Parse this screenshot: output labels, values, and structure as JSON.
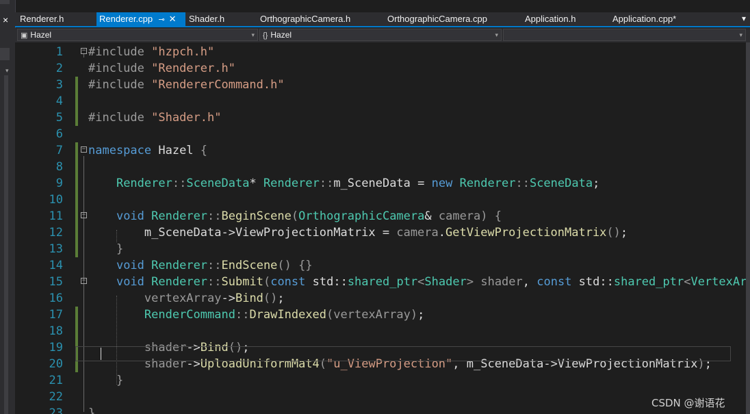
{
  "tabs": [
    {
      "label": "Renderer.h",
      "active": false
    },
    {
      "label": "Renderer.cpp",
      "active": true,
      "pin": "pin-icon",
      "close": "close-icon"
    },
    {
      "label": "Shader.h",
      "active": false
    },
    {
      "label": "OrthographicCamera.h",
      "active": false
    },
    {
      "label": "OrthographicCamera.cpp",
      "active": false
    },
    {
      "label": "Application.h",
      "active": false
    },
    {
      "label": "Application.cpp*",
      "active": false
    }
  ],
  "navbar": {
    "project": "Hazel",
    "scope_icon": "{}",
    "scope": "Hazel",
    "member": ""
  },
  "code_lines": [
    {
      "num": "1",
      "tokens": [
        [
          "pp",
          "#include "
        ],
        [
          "str",
          "\"hzpch.h\""
        ]
      ]
    },
    {
      "num": "2",
      "tokens": [
        [
          "pp",
          "#include "
        ],
        [
          "str",
          "\"Renderer.h\""
        ]
      ]
    },
    {
      "num": "3",
      "tokens": [
        [
          "pp",
          "#include "
        ],
        [
          "str",
          "\"RendererCommand.h\""
        ]
      ]
    },
    {
      "num": "4",
      "tokens": []
    },
    {
      "num": "5",
      "tokens": [
        [
          "pp",
          "#include "
        ],
        [
          "str",
          "\"Shader.h\""
        ]
      ]
    },
    {
      "num": "6",
      "tokens": []
    },
    {
      "num": "7",
      "tokens": [
        [
          "kw",
          "namespace"
        ],
        [
          "pl",
          " Hazel "
        ],
        [
          "par",
          "{"
        ]
      ]
    },
    {
      "num": "8",
      "tokens": []
    },
    {
      "num": "9",
      "tokens": [
        [
          "pl",
          "    "
        ],
        [
          "ty",
          "Renderer"
        ],
        [
          "par",
          "::"
        ],
        [
          "ty",
          "SceneData"
        ],
        [
          "pl",
          "* "
        ],
        [
          "ty",
          "Renderer"
        ],
        [
          "par",
          "::"
        ],
        [
          "pl",
          "m_SceneData = "
        ],
        [
          "kw",
          "new"
        ],
        [
          "pl",
          " "
        ],
        [
          "ty",
          "Renderer"
        ],
        [
          "par",
          "::"
        ],
        [
          "ty",
          "SceneData"
        ],
        [
          "pl",
          ";"
        ]
      ]
    },
    {
      "num": "10",
      "tokens": []
    },
    {
      "num": "11",
      "tokens": [
        [
          "pl",
          "    "
        ],
        [
          "kw",
          "void"
        ],
        [
          "pl",
          " "
        ],
        [
          "ty",
          "Renderer"
        ],
        [
          "par",
          "::"
        ],
        [
          "fn",
          "BeginScene"
        ],
        [
          "par",
          "("
        ],
        [
          "ty",
          "OrthographicCamera"
        ],
        [
          "pl",
          "& "
        ],
        [
          "par",
          "camera"
        ],
        [
          "par",
          ")"
        ],
        [
          "pl",
          " "
        ],
        [
          "par",
          "{"
        ]
      ]
    },
    {
      "num": "12",
      "tokens": [
        [
          "pl",
          "        m_SceneData->"
        ],
        [
          "pl",
          "ViewProjectionMatrix = "
        ],
        [
          "par",
          "camera"
        ],
        [
          "pl",
          "."
        ],
        [
          "fn",
          "GetViewProjectionMatrix"
        ],
        [
          "par",
          "()"
        ],
        [
          "pl",
          ";"
        ]
      ]
    },
    {
      "num": "13",
      "tokens": [
        [
          "pl",
          "    "
        ],
        [
          "par",
          "}"
        ]
      ]
    },
    {
      "num": "14",
      "tokens": [
        [
          "pl",
          "    "
        ],
        [
          "kw",
          "void"
        ],
        [
          "pl",
          " "
        ],
        [
          "ty",
          "Renderer"
        ],
        [
          "par",
          "::"
        ],
        [
          "fn",
          "EndScene"
        ],
        [
          "par",
          "() {}"
        ]
      ]
    },
    {
      "num": "15",
      "tokens": [
        [
          "pl",
          "    "
        ],
        [
          "kw",
          "void"
        ],
        [
          "pl",
          " "
        ],
        [
          "ty",
          "Renderer"
        ],
        [
          "par",
          "::"
        ],
        [
          "fn",
          "Submit"
        ],
        [
          "par",
          "("
        ],
        [
          "kw",
          "const"
        ],
        [
          "pl",
          " std::"
        ],
        [
          "ty",
          "shared_ptr"
        ],
        [
          "par",
          "<"
        ],
        [
          "ty",
          "Shader"
        ],
        [
          "par",
          ">"
        ],
        [
          "pl",
          " "
        ],
        [
          "par",
          "shader"
        ],
        [
          "pl",
          ", "
        ],
        [
          "kw",
          "const"
        ],
        [
          "pl",
          " std::"
        ],
        [
          "ty",
          "shared_ptr"
        ],
        [
          "par",
          "<"
        ],
        [
          "ty",
          "VertexArra"
        ]
      ]
    },
    {
      "num": "16",
      "tokens": [
        [
          "pl",
          "        "
        ],
        [
          "par",
          "vertexArray"
        ],
        [
          "pl",
          "->"
        ],
        [
          "fn",
          "Bind"
        ],
        [
          "par",
          "()"
        ],
        [
          "pl",
          ";"
        ]
      ]
    },
    {
      "num": "17",
      "tokens": [
        [
          "pl",
          "        "
        ],
        [
          "ty",
          "RenderCommand"
        ],
        [
          "par",
          "::"
        ],
        [
          "fn",
          "DrawIndexed"
        ],
        [
          "par",
          "(vertexArray)"
        ],
        [
          "pl",
          ";"
        ]
      ]
    },
    {
      "num": "18",
      "tokens": []
    },
    {
      "num": "19",
      "tokens": [
        [
          "pl",
          "        "
        ],
        [
          "par",
          "shader"
        ],
        [
          "pl",
          "->"
        ],
        [
          "fn",
          "Bind"
        ],
        [
          "par",
          "()"
        ],
        [
          "pl",
          ";"
        ]
      ]
    },
    {
      "num": "20",
      "tokens": [
        [
          "pl",
          "        "
        ],
        [
          "par",
          "shader"
        ],
        [
          "pl",
          "->"
        ],
        [
          "fn",
          "UploadUniformMat4"
        ],
        [
          "par",
          "("
        ],
        [
          "str",
          "\"u_ViewProjection\""
        ],
        [
          "pl",
          ", m_SceneData->ViewProjectionMatrix"
        ],
        [
          "par",
          ")"
        ],
        [
          "pl",
          ";"
        ]
      ]
    },
    {
      "num": "21",
      "tokens": [
        [
          "pl",
          "    "
        ],
        [
          "par",
          "}"
        ]
      ]
    },
    {
      "num": "22",
      "tokens": []
    },
    {
      "num": "23",
      "tokens": [
        [
          "par",
          "}"
        ]
      ]
    }
  ],
  "watermark": "CSDN @谢语花",
  "left_close": "×",
  "overflow": "▾"
}
